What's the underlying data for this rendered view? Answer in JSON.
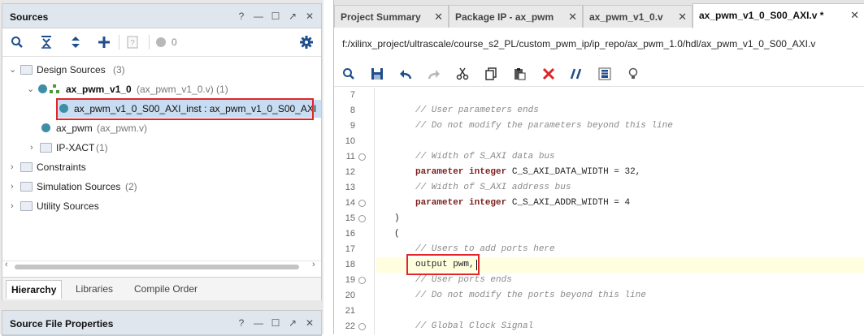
{
  "sources": {
    "title": "Sources",
    "toolbar_count": "0",
    "tree": [
      {
        "label": "Design Sources",
        "suffix": "(3)"
      },
      {
        "label": "ax_pwm_v1_0",
        "suffix": "(ax_pwm_v1_0.v) (1)"
      },
      {
        "label": "ax_pwm_v1_0_S00_AXI_inst : ax_pwm_v1_0_S00_AXI"
      },
      {
        "label": "ax_pwm",
        "suffix": "(ax_pwm.v)"
      },
      {
        "label": "IP-XACT",
        "suffix": "(1)"
      },
      {
        "label": "Constraints"
      },
      {
        "label": "Simulation Sources",
        "suffix": "(2)"
      },
      {
        "label": "Utility Sources"
      }
    ],
    "bottom_tabs": [
      "Hierarchy",
      "Libraries",
      "Compile Order"
    ]
  },
  "properties": {
    "title": "Source File Properties"
  },
  "editor": {
    "tabs": [
      {
        "label": "Project Summary"
      },
      {
        "label": "Package IP - ax_pwm"
      },
      {
        "label": "ax_pwm_v1_0.v"
      },
      {
        "label": "ax_pwm_v1_0_S00_AXI.v *"
      }
    ],
    "file_path": "f:/xilinx_project/ultrascale/course_s2_PL/custom_pwm_ip/ip_repo/ax_pwm_1.0/hdl/ax_pwm_v1_0_S00_AXI.v",
    "lines": [
      {
        "n": "7",
        "t": ""
      },
      {
        "n": "8",
        "t": "// User parameters ends"
      },
      {
        "n": "9",
        "t": "// Do not modify the parameters beyond this line"
      },
      {
        "n": "10",
        "t": ""
      },
      {
        "n": "11",
        "t": "// Width of S_AXI data bus"
      },
      {
        "n": "12",
        "k1": "parameter",
        "k2": "integer",
        "t": " C_S_AXI_DATA_WIDTH = 32,"
      },
      {
        "n": "13",
        "t": "// Width of S_AXI address bus"
      },
      {
        "n": "14",
        "k1": "parameter",
        "k2": "integer",
        "t": " C_S_AXI_ADDR_WIDTH = 4"
      },
      {
        "n": "15",
        "t": ")"
      },
      {
        "n": "16",
        "t": "("
      },
      {
        "n": "17",
        "t": "// Users to add ports here"
      },
      {
        "n": "18",
        "t": "output pwm,"
      },
      {
        "n": "19",
        "t": "// User ports ends"
      },
      {
        "n": "20",
        "t": "// Do not modify the ports beyond this line"
      },
      {
        "n": "21",
        "t": ""
      },
      {
        "n": "22",
        "t": "// Global Clock Signal"
      }
    ]
  },
  "colors": {
    "highlight_box": "#e0262a",
    "keyword": "#7a1e1e",
    "comment": "#8a8a8a",
    "current_line": "#ffffe0",
    "selection": "#c8dcf2"
  }
}
